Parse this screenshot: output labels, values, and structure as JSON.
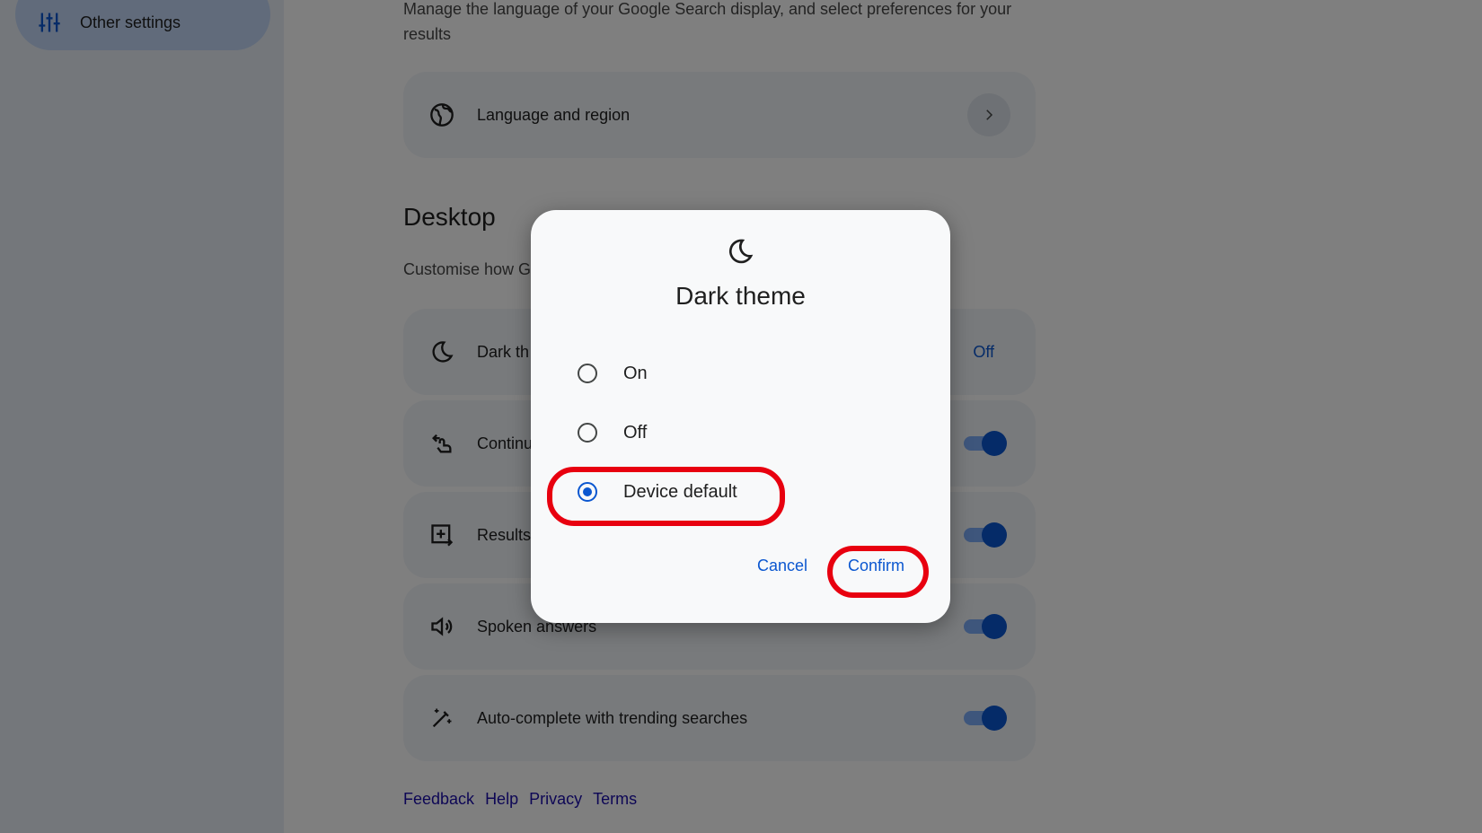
{
  "sidebar": {
    "active_item": "Other settings"
  },
  "intro": {
    "description": "Manage the language of your Google Search display, and select preferences for your results"
  },
  "language_card": {
    "label": "Language and region"
  },
  "desktop": {
    "title": "Desktop",
    "description_visible": "Customise how G",
    "rows": [
      {
        "label": "Dark th",
        "value": "Off",
        "icon": "moon-icon"
      },
      {
        "label": "Continu",
        "toggle": true,
        "icon": "swipe-icon"
      },
      {
        "label": "Results",
        "toggle": true,
        "icon": "new-window-icon"
      },
      {
        "label": "Spoken answers",
        "toggle": true,
        "icon": "speaker-icon"
      },
      {
        "label": "Auto-complete with trending searches",
        "toggle": true,
        "icon": "magic-wand-icon"
      }
    ]
  },
  "footer": {
    "links": [
      "Feedback",
      "Help",
      "Privacy",
      "Terms"
    ]
  },
  "dialog": {
    "title": "Dark theme",
    "icon": "moon-icon",
    "options": [
      "On",
      "Off",
      "Device default"
    ],
    "selected": "Device default",
    "cancel_label": "Cancel",
    "confirm_label": "Confirm",
    "highlight_color": "#e8000f"
  }
}
